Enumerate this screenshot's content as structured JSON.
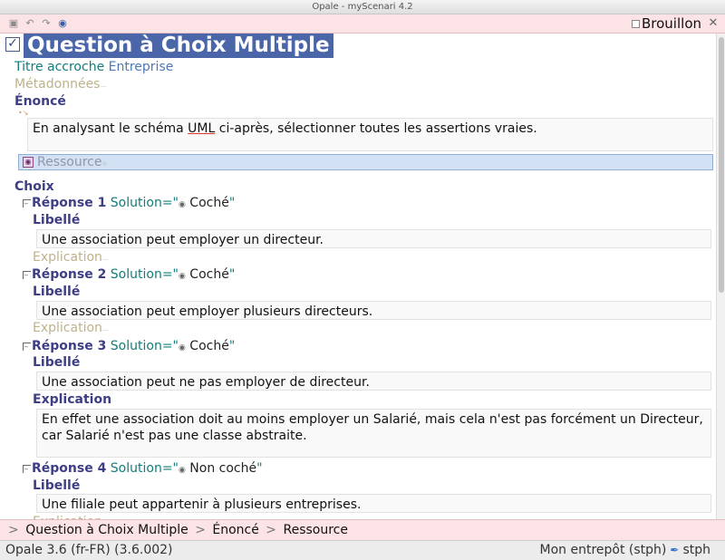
{
  "window": {
    "title": "Opale - myScenari 4.2"
  },
  "toolbar": {
    "icons": [
      "save-icon",
      "undo-icon",
      "redo-icon",
      "info-icon"
    ],
    "brouillon_label": "Brouillon"
  },
  "question": {
    "title": "Question à Choix Multiple",
    "titre_accroche_label": "Titre accroche",
    "titre_accroche_value": "Entreprise",
    "metadonnees_label": "Métadonnées",
    "enonce_label": "Énoncé",
    "enonce_text_before": "En analysant le schéma ",
    "enonce_text_uml": "UML",
    "enonce_text_after": " ci-après, sélectionner toutes les assertions vraies.",
    "ressource_label": "Ressource",
    "choix_label": "Choix"
  },
  "labels": {
    "libelle": "Libellé",
    "explication": "Explication",
    "solution_prefix": "Solution=\"",
    "solution_suffix": "\""
  },
  "reponses": [
    {
      "label": "Réponse 1",
      "solution": "Coché",
      "libelle": "Une association peut employer un directeur."
    },
    {
      "label": "Réponse 2",
      "solution": "Coché",
      "libelle": "Une association peut employer plusieurs directeurs."
    },
    {
      "label": "Réponse 3",
      "solution": "Coché",
      "libelle": "Une association peut ne pas employer de directeur.",
      "explication": "En effet une association doit au moins employer un Salarié, mais cela n'est pas forcément un Directeur, car Salarié n'est pas une classe abstraite."
    },
    {
      "label": "Réponse 4",
      "solution": "Non coché",
      "libelle": "Une filiale peut appartenir à plusieurs entreprises."
    }
  ],
  "breadcrumb": {
    "sep": ">",
    "items": [
      "Question à Choix Multiple",
      "Énoncé",
      "Ressource"
    ]
  },
  "status": {
    "left": "Opale 3.6 (fr-FR) (3.6.002)",
    "workspace": "Mon entrepôt (stph)",
    "user": "stph"
  }
}
